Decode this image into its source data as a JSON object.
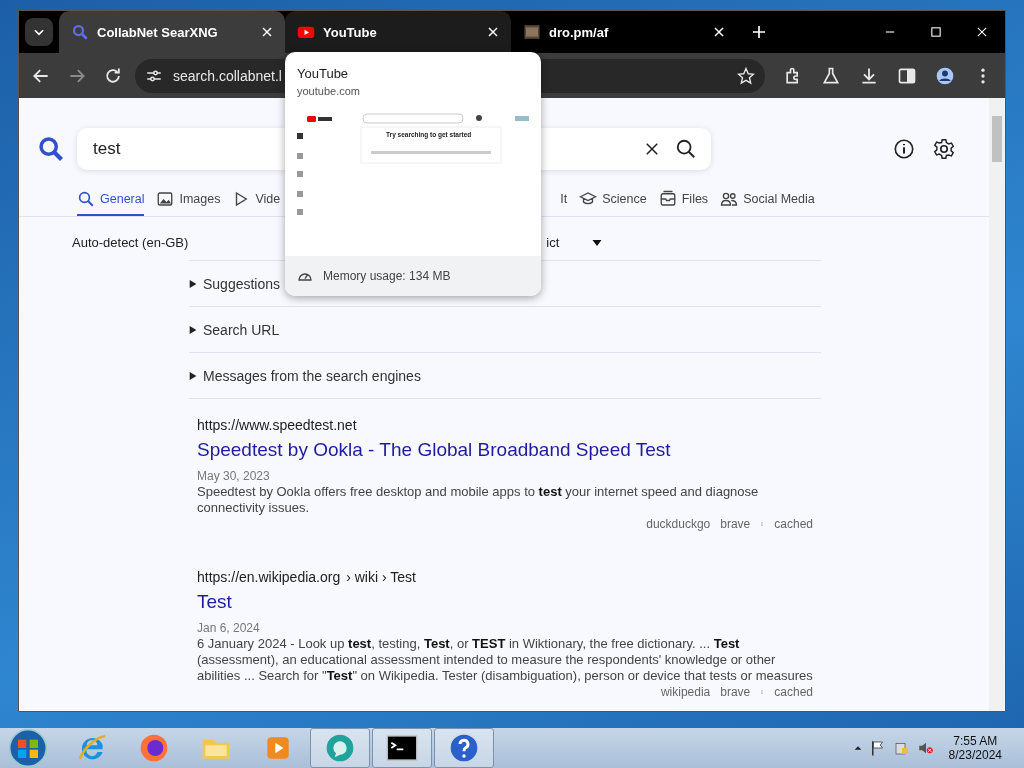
{
  "browser": {
    "tabs": [
      {
        "title": "CollabNet SearXNG",
        "selected": true
      },
      {
        "title": "YouTube",
        "selected": false
      },
      {
        "title": "dro.pm/af",
        "selected": false
      }
    ],
    "address": "search.collabnet.l"
  },
  "page": {
    "query": "test",
    "categories": [
      {
        "label": "General",
        "selected": true
      },
      {
        "label": "Images",
        "selected": false
      },
      {
        "label": "Vide",
        "selected": false
      },
      {
        "label": "It",
        "selected": false
      },
      {
        "label": "Science",
        "selected": false
      },
      {
        "label": "Files",
        "selected": false
      },
      {
        "label": "Social Media",
        "selected": false
      }
    ],
    "language": "Auto-detect (en-GB)",
    "safesearch": "ict",
    "sections": [
      {
        "label": "Suggestions",
        "expanded": false
      },
      {
        "label": "Search URL",
        "expanded": false
      },
      {
        "label": "Messages from the search engines",
        "expanded": false
      }
    ],
    "results": [
      {
        "url": "https://www.speedtest.net",
        "title": "Speedtest by Ookla - The Global Broadband Speed Test",
        "date": "May 30, 2023",
        "snippet": "Speedtest by Ookla offers free desktop and mobile apps to **test** your internet speed and diagnose connectivity issues.",
        "engines": [
          "duckduckgo",
          "brave"
        ],
        "cached": "cached"
      },
      {
        "url": "https://en.wikipedia.org",
        "path": "› wiki › Test",
        "title": "Test",
        "date": "Jan 6, 2024",
        "snippet": "6 January 2024 - Look up **test**, testing, **Test**, or **TEST** in Wiktionary, the free dictionary. ... **Test** (assessment), an educational assessment intended to measure the respondents' knowledge or other abilities ... Search for \"**Test**\" on Wikipedia. Tester (disambiguation), person or device that tests or measures",
        "engines": [
          "wikipedia",
          "brave"
        ],
        "cached": "cached"
      }
    ]
  },
  "tab_preview": {
    "title": "YouTube",
    "url": "youtube.com",
    "thumbnail_text": "Try searching to get started",
    "memory": "Memory usage: 134 MB"
  },
  "taskbar": {
    "apps": [
      {
        "kind": "ie",
        "active": false
      },
      {
        "kind": "firefox",
        "active": false
      },
      {
        "kind": "folder",
        "active": false
      },
      {
        "kind": "media",
        "active": false
      },
      {
        "kind": "chat",
        "active": true
      },
      {
        "kind": "terminal",
        "active": true
      },
      {
        "kind": "help",
        "active": true
      }
    ],
    "time": "7:55 AM",
    "date": "8/23/2024"
  }
}
